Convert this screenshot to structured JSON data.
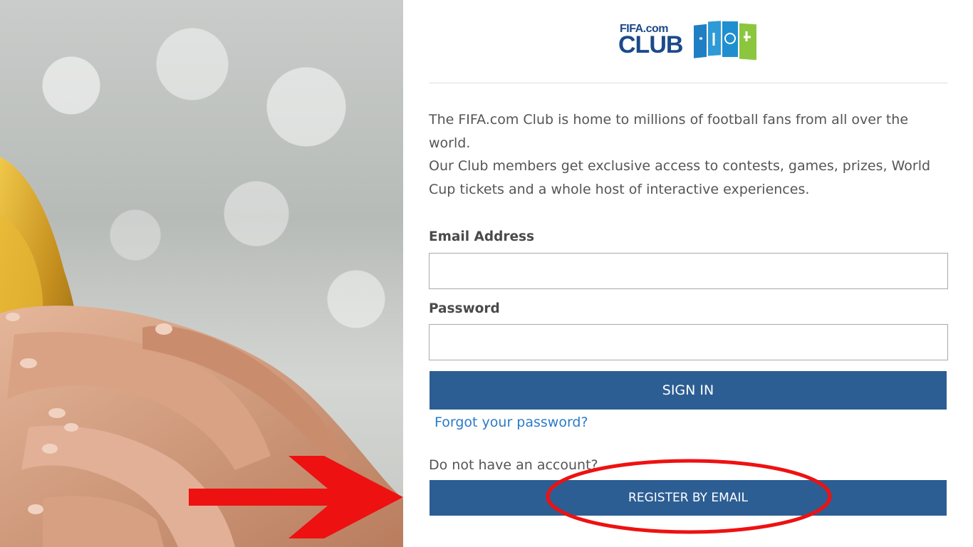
{
  "logo": {
    "fifa_text": "FIFA.com",
    "club_text": "CLUB"
  },
  "intro": {
    "line1": "The FIFA.com Club is home to millions of football fans from all over the world.",
    "line2": "Our Club members get exclusive access to contests, games, prizes, World Cup tickets and a whole host of interactive experiences."
  },
  "form": {
    "email_label": "Email Address",
    "email_value": "",
    "password_label": "Password",
    "password_value": "",
    "signin_label": "SIGN IN",
    "forgot_label": "Forgot your password?",
    "no_account_text": "Do not have an account?",
    "register_label": "REGISTER BY EMAIL"
  },
  "colors": {
    "button_bg": "#2c5e93",
    "link": "#2a7bc8",
    "annotation": "#ee1111"
  },
  "icons": {
    "annotation_arrow": "red-arrow-icon",
    "annotation_circle": "red-circle-highlight"
  }
}
